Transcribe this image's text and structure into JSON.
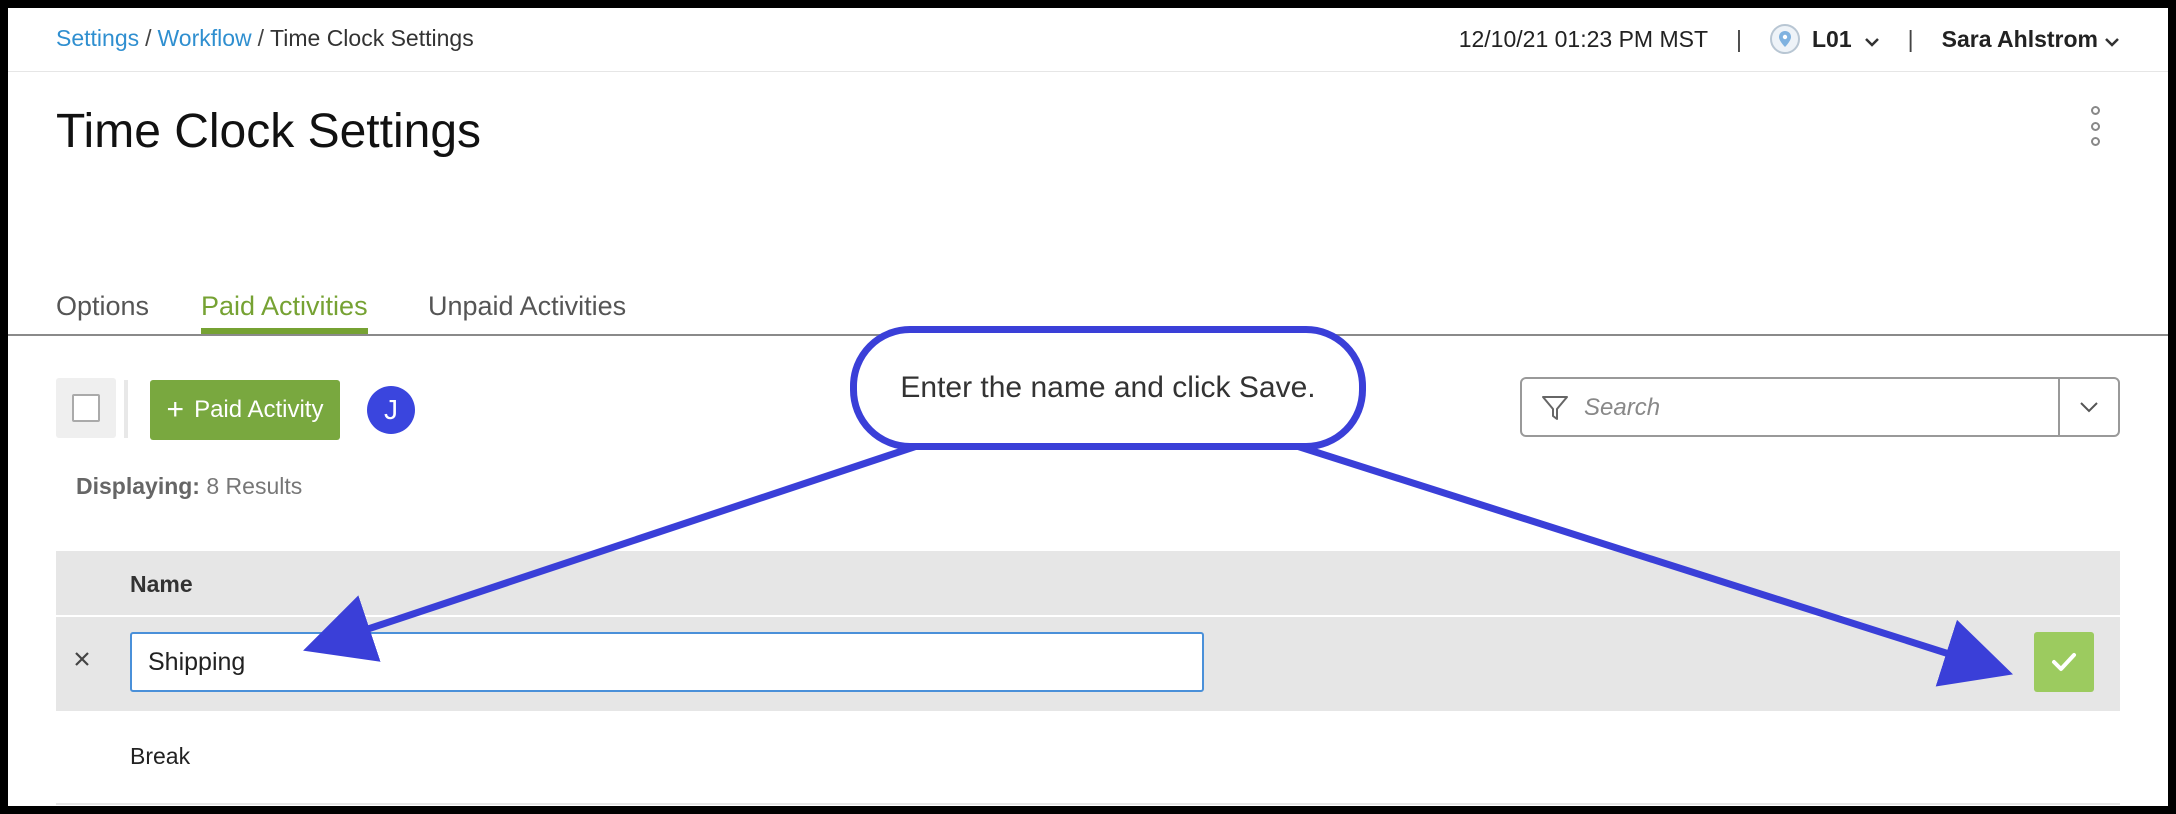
{
  "breadcrumb": {
    "settings": "Settings",
    "workflow": "Workflow",
    "current": "Time Clock Settings",
    "sep": "/"
  },
  "header": {
    "datetime": "12/10/21 01:23 PM MST",
    "pipe": "|",
    "location": "L01",
    "user": "Sara Ahlstrom"
  },
  "page": {
    "title": "Time Clock Settings"
  },
  "tabs": [
    {
      "label": "Options",
      "active": false
    },
    {
      "label": "Paid Activities",
      "active": true
    },
    {
      "label": "Unpaid Activities",
      "active": false
    }
  ],
  "toolbar": {
    "add_label": "Paid Activity",
    "avatar_initial": "J"
  },
  "search": {
    "placeholder": "Search",
    "value": ""
  },
  "results": {
    "label": "Displaying:",
    "value": "8 Results"
  },
  "table": {
    "columns": [
      "Name"
    ],
    "editing_row": {
      "value": "Shipping"
    },
    "rows": [
      {
        "name": "Break"
      }
    ]
  },
  "annotation": {
    "text": "Enter the name and click Save."
  },
  "colors": {
    "accent_green": "#76a233",
    "save_green": "#9ccb5f",
    "link_blue": "#2f8fd0",
    "annotation_blue": "#3a3fd8"
  }
}
